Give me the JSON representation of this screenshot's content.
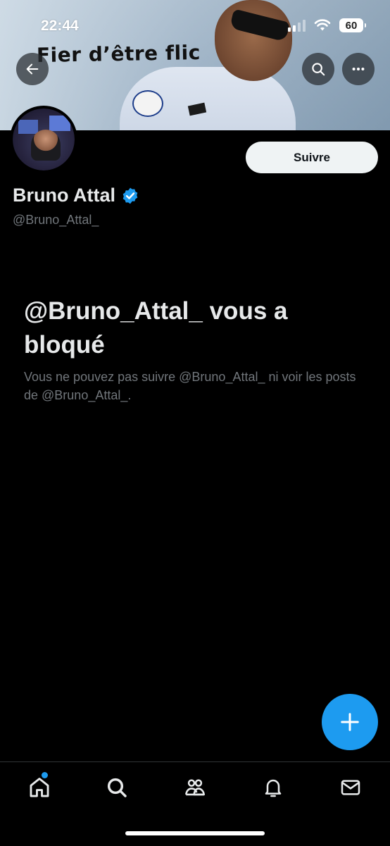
{
  "status_bar": {
    "time": "22:44",
    "battery": "60"
  },
  "header": {
    "banner_text": "Fier d’être flic"
  },
  "profile": {
    "display_name": "Bruno Attal",
    "handle": "@Bruno_Attal_",
    "follow_label": "Suivre",
    "verified": true
  },
  "blocked": {
    "title": "@Bruno_Attal_ vous a bloqué",
    "description": "Vous ne pouvez pas suivre @Bruno_Attal_ ni voir les posts de @Bruno_Attal_."
  },
  "tabs": [
    {
      "icon": "home-icon",
      "has_notification_dot": true
    },
    {
      "icon": "search-icon"
    },
    {
      "icon": "communities-icon"
    },
    {
      "icon": "bell-icon"
    },
    {
      "icon": "mail-icon"
    }
  ],
  "colors": {
    "accent": "#1d9bf0",
    "background": "#000000",
    "text_primary": "#e7e9ea",
    "text_secondary": "#71767b"
  }
}
